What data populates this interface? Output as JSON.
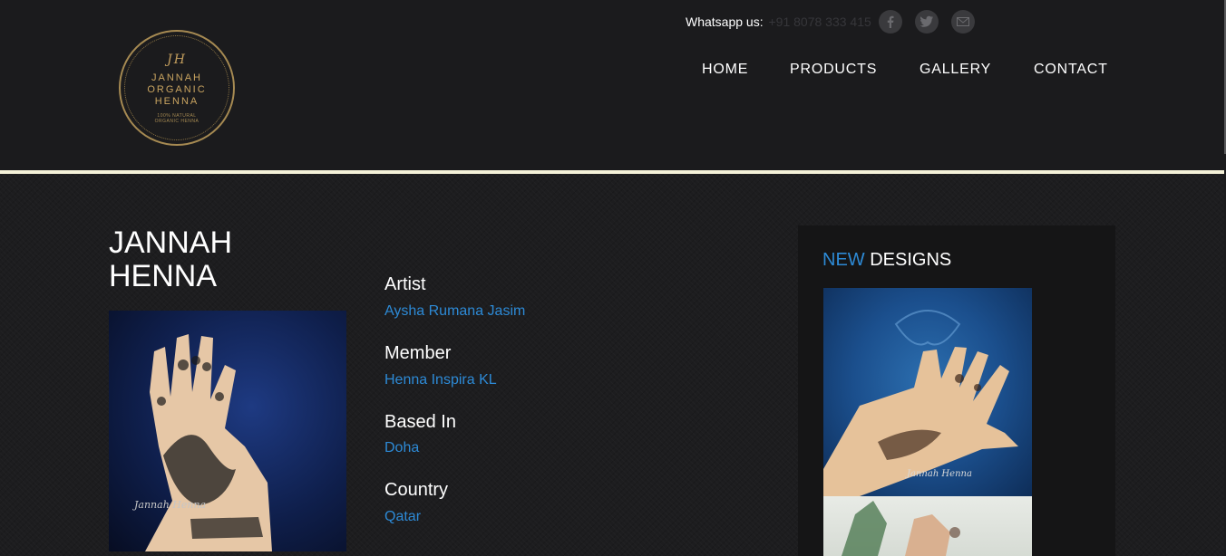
{
  "header": {
    "logo": {
      "monogram": "JH",
      "name": "JANNAH ORGANIC HENNA",
      "tagline": "100% NATURAL ORGANIC HENNA"
    },
    "contact": {
      "whatsapp_label": "Whatsapp us:",
      "whatsapp_number": "+91 8078 333 415"
    },
    "social": [
      "facebook-icon",
      "twitter-icon",
      "email-icon"
    ],
    "nav": {
      "home": "HOME",
      "products": "PRODUCTS",
      "gallery": "GALLERY",
      "contact": "CONTACT"
    }
  },
  "main": {
    "title": "JANNAH HENNA",
    "photo_caption": "Jannah Henna",
    "details": [
      {
        "label": "Artist",
        "value": "Aysha Rumana Jasim"
      },
      {
        "label": "Member",
        "value": "Henna Inspira KL"
      },
      {
        "label": "Based In",
        "value": "Doha"
      },
      {
        "label": "Country",
        "value": "Qatar"
      }
    ]
  },
  "sidebar": {
    "title_accent": "NEW",
    "title_rest": "DESIGNS",
    "thumb1_caption": "Jannah Henna"
  },
  "colors": {
    "background": "#1b1b1d",
    "accent_blue": "#2d8ad6",
    "header_line": "#f4f1d8",
    "logo_gold": "#c9a460"
  }
}
